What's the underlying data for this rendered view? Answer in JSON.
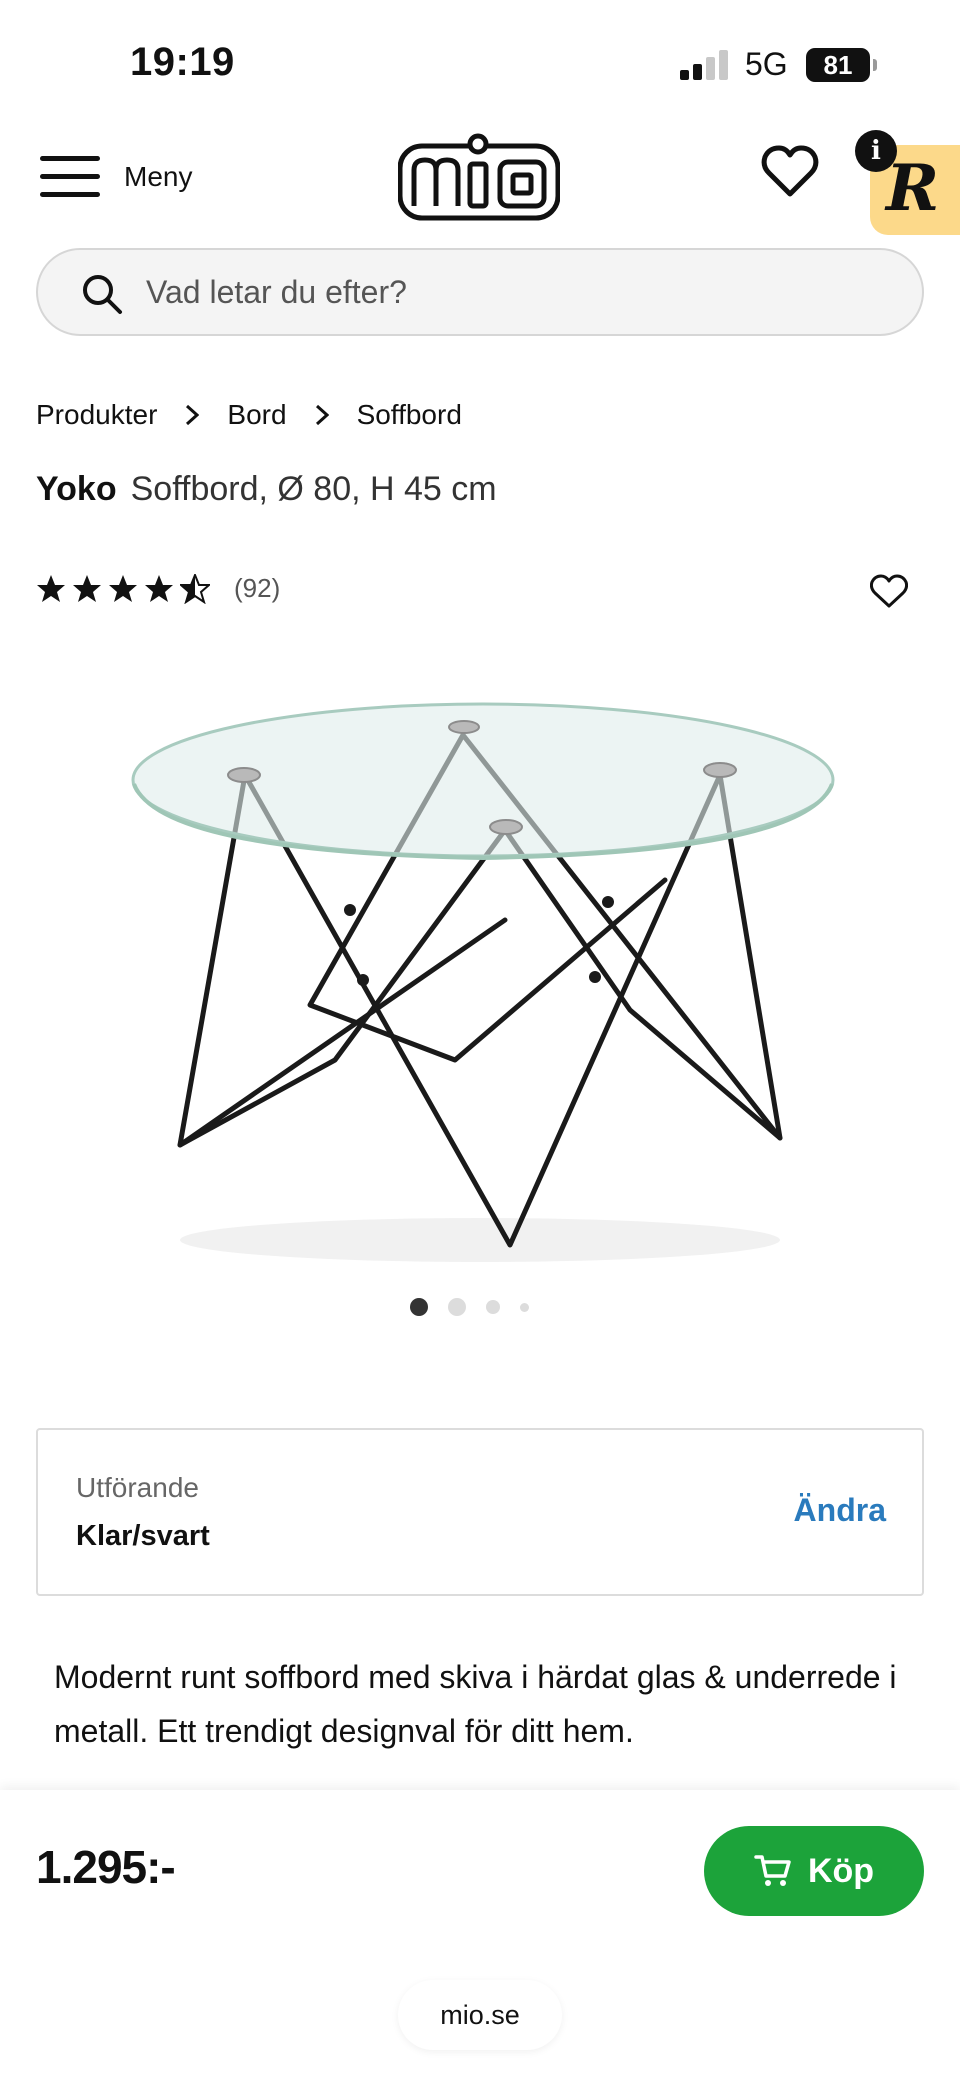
{
  "status_bar": {
    "time": "19:19",
    "network": "5G",
    "battery": "81"
  },
  "header": {
    "menu_label": "Meny",
    "logo_text": "mio",
    "icons": [
      "hamburger-menu-icon",
      "heart-icon",
      "info-icon",
      "r-badge-icon"
    ]
  },
  "search": {
    "placeholder": "Vad letar du efter?"
  },
  "breadcrumb": {
    "items": [
      "Produkter",
      "Bord",
      "Soffbord"
    ]
  },
  "product": {
    "brand": "Yoko",
    "subtitle": "Soffbord, Ø 80, H 45 cm",
    "rating": 4.5,
    "review_count": "(92)",
    "image_count": 4,
    "active_image": 1
  },
  "variant": {
    "label": "Utförande",
    "value": "Klar/svart",
    "change_label": "Ändra"
  },
  "description": "Modernt runt soffbord med skiva i härdat glas & underrede i metall. Ett trendigt designval för ditt hem.",
  "purchase": {
    "price": "1.295:-",
    "buy_label": "Köp"
  },
  "browser": {
    "url": "mio.se"
  },
  "colors": {
    "buy_button": "#1ca33a",
    "link": "#2a7bbd",
    "badge": "#fcd98a"
  }
}
